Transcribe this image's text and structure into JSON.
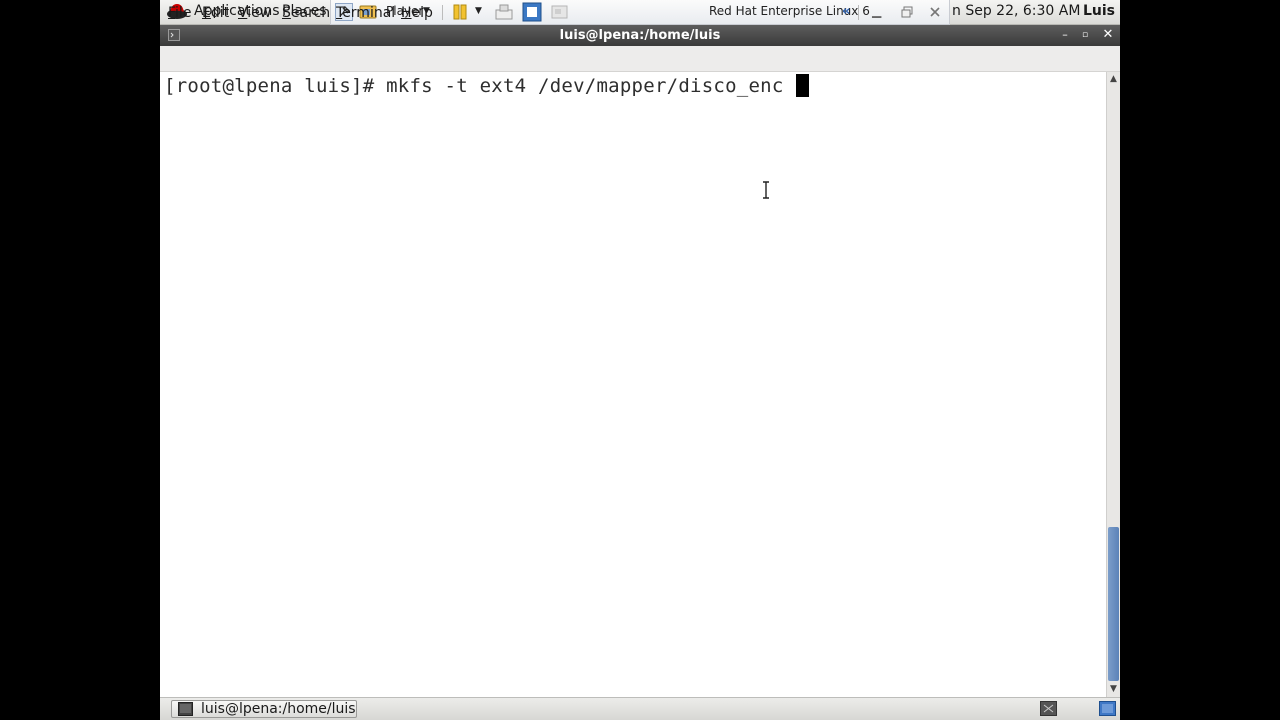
{
  "top_panel": {
    "applications": "Applications",
    "places": "Places",
    "clock": "n Sep 22,  6:30 AM",
    "user": "Luis"
  },
  "vmware": {
    "player_label": "Player",
    "vm_name": "Red Hat Enterprise Linux 6"
  },
  "window": {
    "title": "luis@lpena:/home/luis"
  },
  "menu": {
    "file": "F",
    "file_rest": "ile",
    "edit": "E",
    "edit_rest": "dit",
    "view": "V",
    "view_rest": "iew",
    "search": "S",
    "search_rest": "earch",
    "terminal": "T",
    "terminal_rest": "erminal",
    "help": "H",
    "help_rest": "elp"
  },
  "terminal": {
    "prompt": "[root@lpena luis]# ",
    "command": "mkfs -t ext4 /dev/mapper/disco_enc "
  },
  "taskbar": {
    "task_label": "luis@lpena:/home/luis"
  },
  "colors": {
    "title_bar": "#4a4a4a",
    "scroll_thumb": "#6a8fc2",
    "terminal_bg": "#ffffff"
  }
}
